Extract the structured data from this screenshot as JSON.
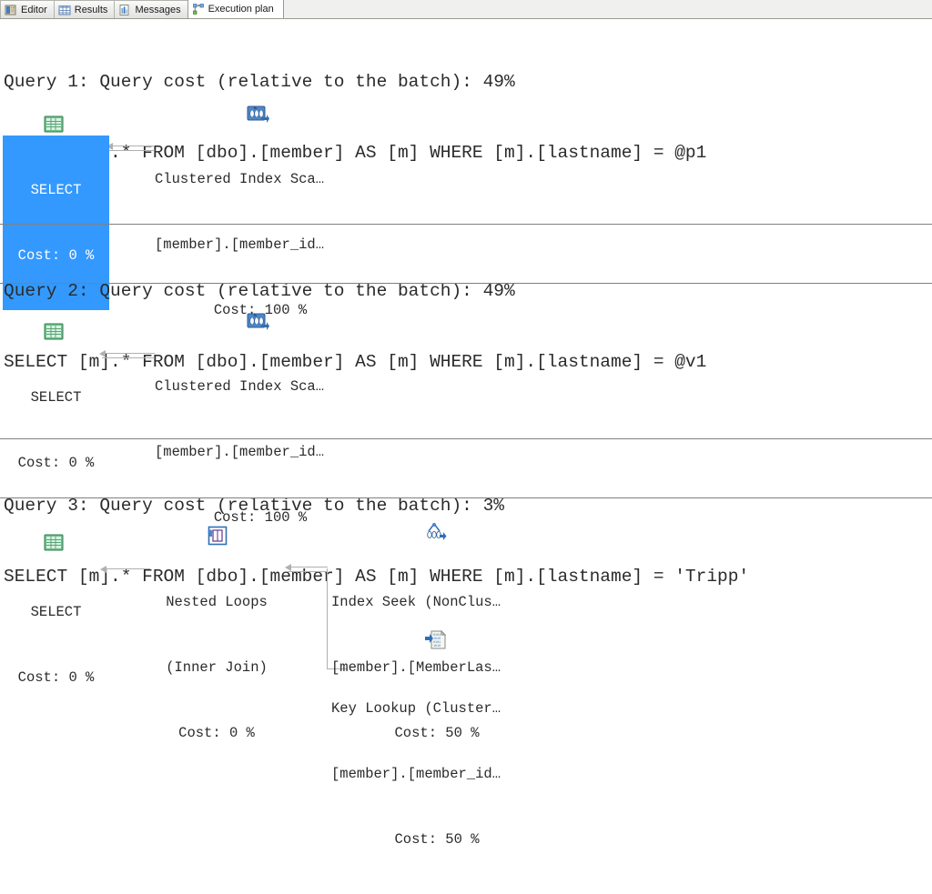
{
  "window": {
    "title": "Execution plan"
  },
  "tabs": [
    {
      "label": "Editor",
      "icon": "editor-icon",
      "active": false
    },
    {
      "label": "Results",
      "icon": "grid-icon",
      "active": false
    },
    {
      "label": "Messages",
      "icon": "messages-icon",
      "active": false
    },
    {
      "label": "Execution plan",
      "icon": "execution-plan-icon",
      "active": true
    }
  ],
  "colors": {
    "selection": "#3399ff",
    "selection_text": "#ffffff",
    "text": "#2b2b2b",
    "connector": "#b0b0b0",
    "separator": "#808080"
  },
  "queries": [
    {
      "id": "query-1",
      "header": "Query 1: Query cost (relative to the batch): 49%",
      "sql": "SELECT [m].* FROM [dbo].[member] AS [m] WHERE [m].[lastname] = @p1",
      "cost_percent": "49%",
      "nodes": [
        {
          "name": "select-node",
          "icon": "select-result-icon",
          "lines": [
            "SELECT",
            "Cost: 0 %"
          ],
          "selected": true
        },
        {
          "name": "clustered-index-scan-node",
          "icon": "clustered-index-scan-icon",
          "lines": [
            "Clustered Index Sca…",
            "[member].[member_id…",
            "Cost: 100 %"
          ],
          "selected": false
        }
      ]
    },
    {
      "id": "query-2",
      "header": "Query 2: Query cost (relative to the batch): 49%",
      "sql": "SELECT [m].* FROM [dbo].[member] AS [m] WHERE [m].[lastname] = @v1",
      "cost_percent": "49%",
      "nodes": [
        {
          "name": "select-node",
          "icon": "select-result-icon",
          "lines": [
            "SELECT",
            "Cost: 0 %"
          ],
          "selected": false
        },
        {
          "name": "clustered-index-scan-node",
          "icon": "clustered-index-scan-icon",
          "lines": [
            "Clustered Index Sca…",
            "[member].[member_id…",
            "Cost: 100 %"
          ],
          "selected": false
        }
      ]
    },
    {
      "id": "query-3",
      "header": "Query 3: Query cost (relative to the batch): 3%",
      "sql": "SELECT [m].* FROM [dbo].[member] AS [m] WHERE [m].[lastname] = 'Tripp'",
      "cost_percent": "3%",
      "nodes": [
        {
          "name": "select-node",
          "icon": "select-result-icon",
          "lines": [
            "SELECT",
            "Cost: 0 %"
          ],
          "selected": false
        },
        {
          "name": "nested-loops-node",
          "icon": "nested-loops-icon",
          "lines": [
            "Nested Loops",
            "(Inner Join)",
            "Cost: 0 %"
          ],
          "selected": false
        },
        {
          "name": "index-seek-node",
          "icon": "index-seek-icon",
          "lines": [
            "Index Seek (NonClus…",
            "[member].[MemberLas…",
            "Cost: 50 %"
          ],
          "selected": false
        },
        {
          "name": "key-lookup-node",
          "icon": "key-lookup-icon",
          "lines": [
            "Key Lookup (Cluster…",
            "[member].[member_id…",
            "Cost: 50 %"
          ],
          "selected": false
        }
      ]
    }
  ]
}
